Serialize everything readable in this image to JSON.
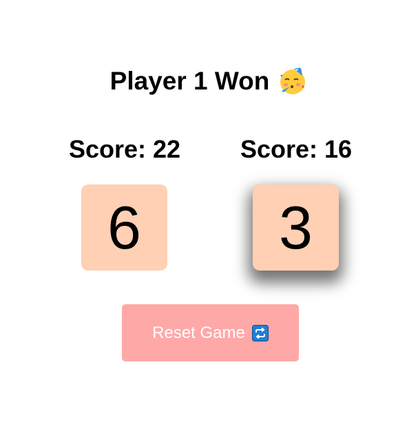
{
  "game": {
    "status": "Player 1 Won",
    "status_icon": "partying-face-icon"
  },
  "players": [
    {
      "score_text": "Score: 22",
      "die_value": "6",
      "active": false
    },
    {
      "score_text": "Score: 16",
      "die_value": "3",
      "active": true
    }
  ],
  "reset": {
    "label": "Reset Game",
    "icon": "repeat-icon"
  },
  "colors": {
    "die_background": "#ffd0b3",
    "button_background": "#ffa8a8",
    "button_text": "#ffffff",
    "icon_blue": "#1f7fd6"
  }
}
